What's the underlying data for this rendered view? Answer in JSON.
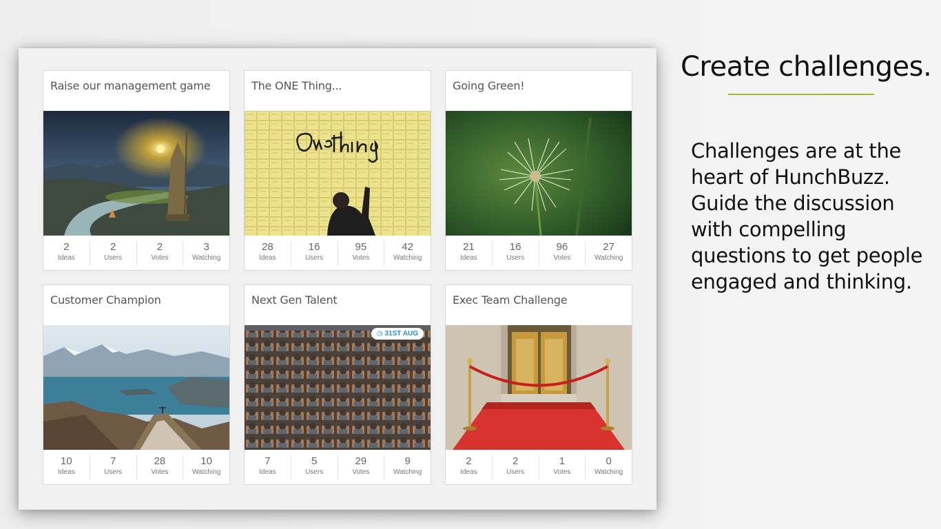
{
  "heading": "Create challenges.",
  "description": "Challenges are at the heart of HunchBuzz. Guide the discussion with compelling questions to get people engaged and thinking.",
  "accent_color": "#9bbb2c",
  "stat_labels": {
    "ideas": "Ideas",
    "users": "Users",
    "votes": "Votes",
    "watching": "Watching"
  },
  "challenges": [
    {
      "title": "Raise our management game",
      "image": "lantern-statue-landscape",
      "ideas": "2",
      "users": "2",
      "votes": "2",
      "watching": "3"
    },
    {
      "title": "The ONE Thing...",
      "image": "one-thing-sticky-notes-wall",
      "ideas": "28",
      "users": "16",
      "votes": "95",
      "watching": "42"
    },
    {
      "title": "Going Green!",
      "image": "dandelion",
      "ideas": "21",
      "users": "16",
      "votes": "96",
      "watching": "27"
    },
    {
      "title": "Customer Champion",
      "image": "mountain-lake-summit",
      "ideas": "10",
      "users": "7",
      "votes": "28",
      "watching": "10"
    },
    {
      "title": "Next Gen Talent",
      "image": "auditorium-audience",
      "badge": "31ST AUG",
      "ideas": "7",
      "users": "5",
      "votes": "29",
      "watching": "9"
    },
    {
      "title": "Exec Team Challenge",
      "image": "red-carpet-entrance",
      "ideas": "2",
      "users": "2",
      "votes": "1",
      "watching": "0"
    }
  ]
}
